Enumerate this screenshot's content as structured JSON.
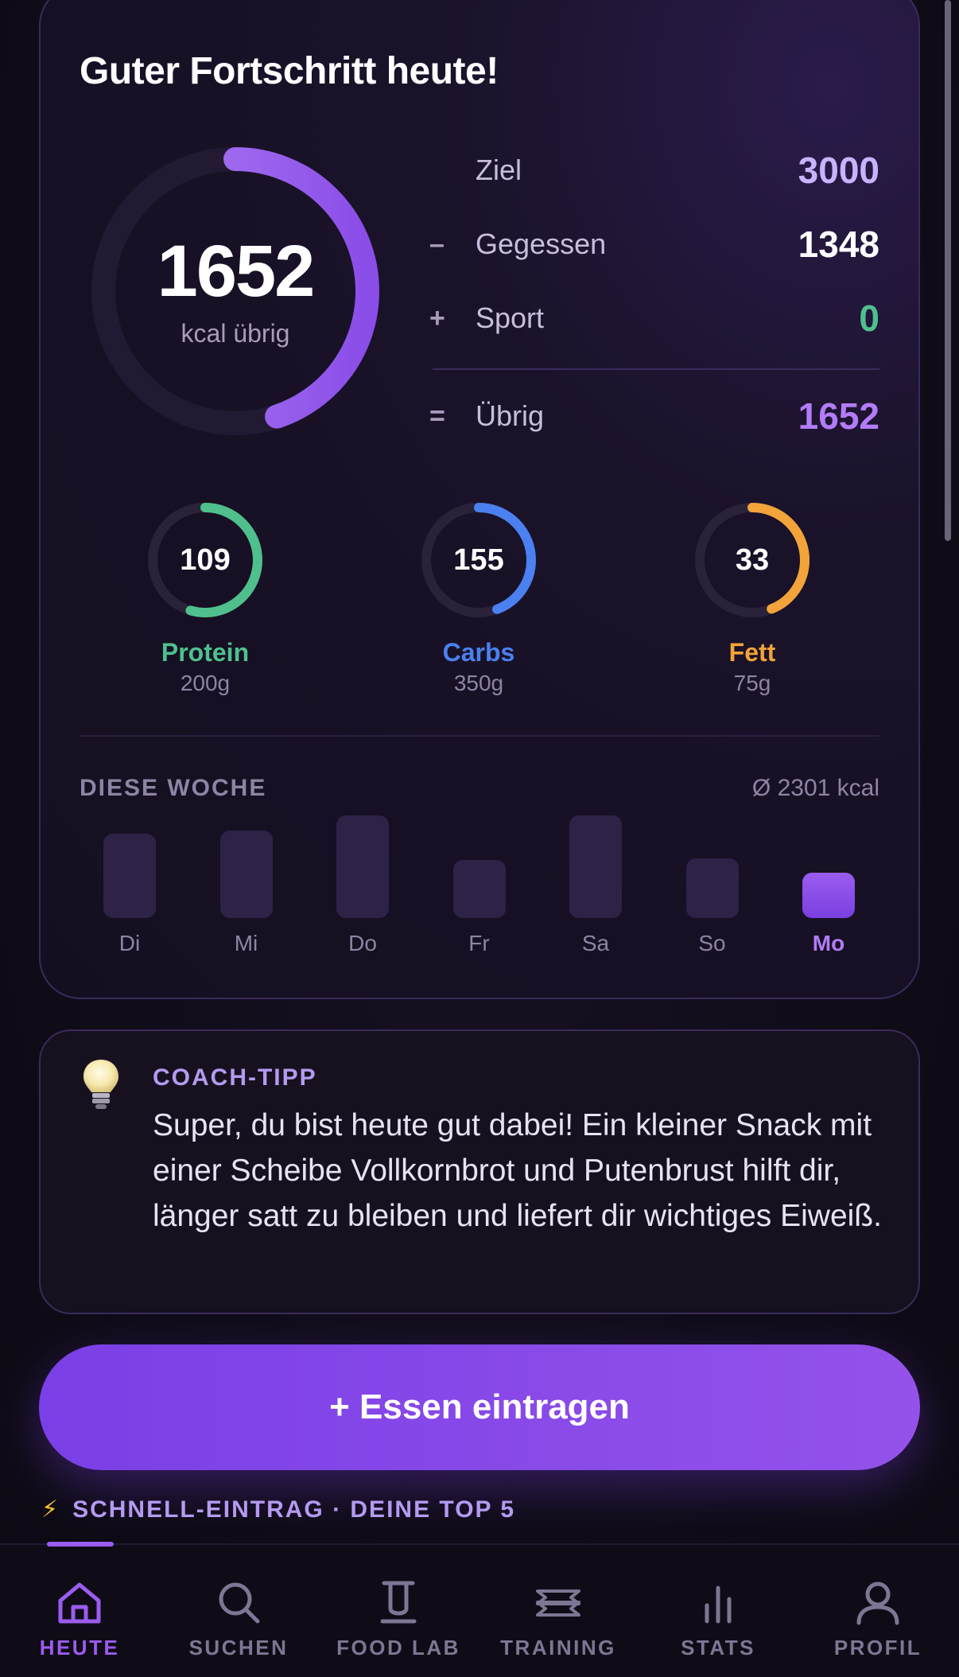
{
  "header": {
    "title": "Guter Fortschritt heute!"
  },
  "calories": {
    "remaining": "1652",
    "remaining_label": "kcal übrig",
    "progress": 0.449
  },
  "summary": [
    {
      "op": "",
      "label": "Ziel",
      "value": "3000",
      "color": "#c9b2ff"
    },
    {
      "op": "–",
      "label": "Gegessen",
      "value": "1348",
      "color": "#ffffff"
    },
    {
      "op": "+",
      "label": "Sport",
      "value": "0",
      "color": "#4fc08d"
    },
    {
      "op": "=",
      "label": "Übrig",
      "value": "1652",
      "color": "#b27cf7"
    }
  ],
  "macros": [
    {
      "value": "109",
      "name": "Protein",
      "goal": "200g",
      "color": "#4fc08d",
      "progress": 0.545
    },
    {
      "value": "155",
      "name": "Carbs",
      "goal": "350g",
      "color": "#4b80f0",
      "progress": 0.443
    },
    {
      "value": "33",
      "name": "Fett",
      "goal": "75g",
      "color": "#f2a33a",
      "progress": 0.44
    }
  ],
  "week": {
    "title": "DIESE WOCHE",
    "average": "Ø 2301 kcal",
    "days": [
      {
        "label": "Di",
        "level": 0.73,
        "active": false
      },
      {
        "label": "Mi",
        "level": 0.76,
        "active": false
      },
      {
        "label": "Do",
        "level": 0.89,
        "active": false
      },
      {
        "label": "Fr",
        "level": 0.5,
        "active": false
      },
      {
        "label": "Sa",
        "level": 0.89,
        "active": false
      },
      {
        "label": "So",
        "level": 0.52,
        "active": false
      },
      {
        "label": "Mo",
        "level": 0.39,
        "active": true
      }
    ]
  },
  "coach": {
    "title": "COACH-TIPP",
    "text": "Super, du bist heute gut dabei! Ein kleiner Snack mit einer Scheibe Vollkornbrot und Putenbrust hilft dir, länger satt zu bleiben und liefert dir wichtiges Eiweiß.",
    "icon": "lightbulb-icon"
  },
  "add_button": {
    "label": "+ Essen eintragen"
  },
  "quick_entry": {
    "title": "SCHNELL-EINTRAG · DEINE TOP 5",
    "icon": "lightning-icon"
  },
  "nav": [
    {
      "label": "HEUTE",
      "icon": "home-icon",
      "active": true
    },
    {
      "label": "SUCHEN",
      "icon": "search-icon",
      "active": false
    },
    {
      "label": "FOOD LAB",
      "icon": "beaker-icon",
      "active": false
    },
    {
      "label": "TRAINING",
      "icon": "dumbbell-icon",
      "active": false
    },
    {
      "label": "STATS",
      "icon": "stats-icon",
      "active": false
    },
    {
      "label": "PROFIL",
      "icon": "profile-icon",
      "active": false
    }
  ],
  "colors": {
    "accent": "#9b5cf0",
    "background": "#0f0b17",
    "card": "#17111f"
  }
}
